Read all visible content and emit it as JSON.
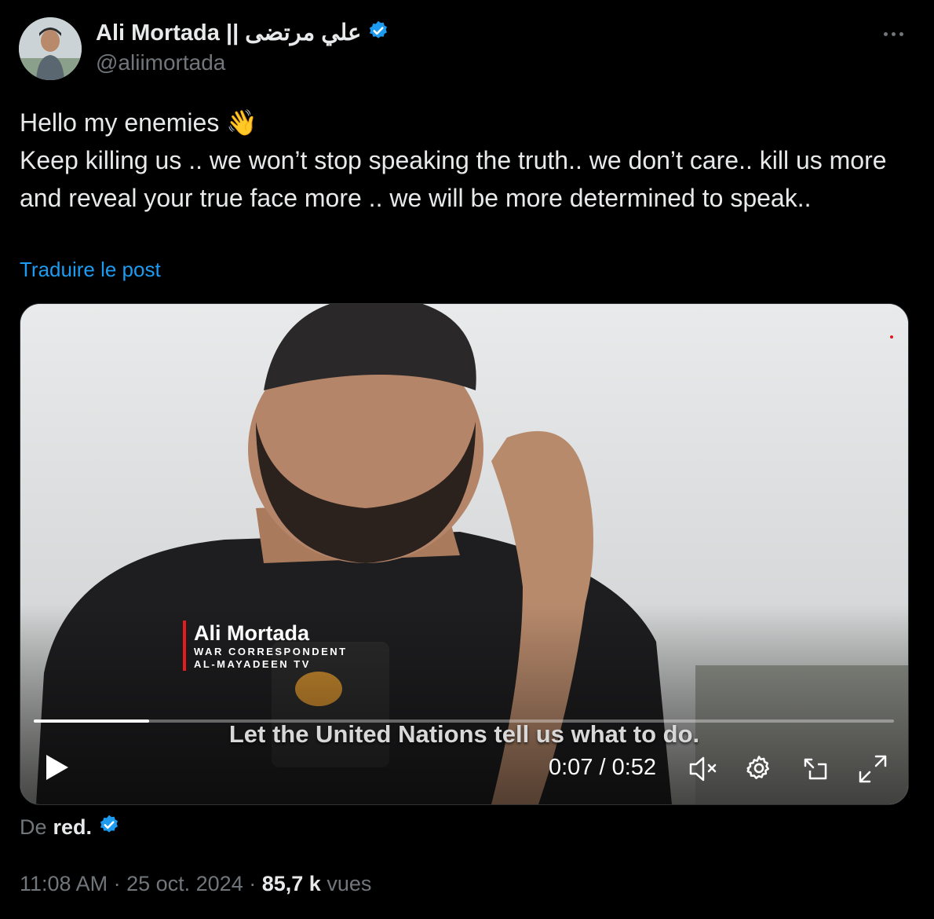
{
  "author": {
    "display_name": "Ali Mortada || علي مرتضى",
    "handle": "@aliimortada",
    "verified": true
  },
  "tweet": {
    "line1": "Hello my enemies 👋",
    "line2": "Keep killing us .. we won’t stop speaking the truth.. we don’t care.. kill us more and reveal your true face more .. we will be more determined to speak..",
    "translate_label": "Traduire le post"
  },
  "video": {
    "overlay_name": "Ali Mortada",
    "overlay_role": "WAR CORRESPONDENT",
    "overlay_channel": "AL-MAYADEEN TV",
    "subtitle": "Let the United Nations tell us what to do.",
    "time_display": "0:07 / 0:52",
    "progress": 0.134,
    "muted": true
  },
  "source": {
    "prefix": "De",
    "account": "red."
  },
  "meta": {
    "time": "11:08 AM",
    "date": "25 oct. 2024",
    "views_count": "85,7 k",
    "views_label": "vues"
  },
  "colors": {
    "background": "#000000",
    "text_primary": "#e7e9ea",
    "text_secondary": "#71767b",
    "accent": "#1d9bf0",
    "lower_third_bar": "#e11d1d"
  }
}
